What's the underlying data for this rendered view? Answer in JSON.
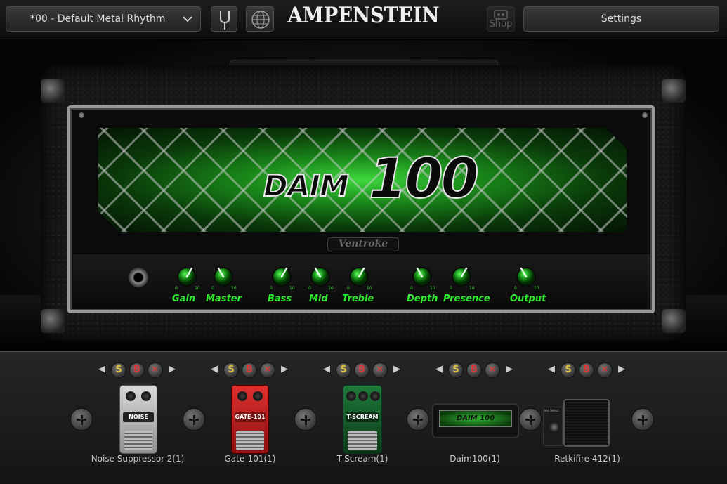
{
  "app": {
    "brand": "AMPENSTEIN",
    "preset": "*00 - Default Metal Rhythm",
    "shop_label": "Shop",
    "settings_label": "Settings"
  },
  "amp": {
    "logo_word": "DAIM",
    "logo_number": "100",
    "badge": "Ventroke",
    "knobs": [
      {
        "label": "Gain"
      },
      {
        "label": "Master"
      },
      {
        "label": "Bass"
      },
      {
        "label": "Mid"
      },
      {
        "label": "Treble"
      },
      {
        "label": "Depth"
      },
      {
        "label": "Presence"
      },
      {
        "label": "Output"
      }
    ]
  },
  "chain": {
    "controls": {
      "solo": "S",
      "bypass": "B",
      "remove": "✕",
      "left": "◀",
      "right": "▶"
    },
    "slots": [
      {
        "label": "Noise Suppressor-2(1)",
        "pedal_text": "NOISE"
      },
      {
        "label": "Gate-101(1)",
        "pedal_text": "GATE-101"
      },
      {
        "label": "T-Scream(1)",
        "pedal_text": "T-SCREAM"
      },
      {
        "label": "Daim100(1)",
        "pedal_text": "DAIM 100"
      },
      {
        "label": "Retkifire 412(1)",
        "pedal_text": "Mic Select"
      }
    ]
  },
  "colors": {
    "accent_green": "#2ee82e",
    "solo_yellow": "#d8c23a",
    "bypass_red": "#d23a3a"
  }
}
